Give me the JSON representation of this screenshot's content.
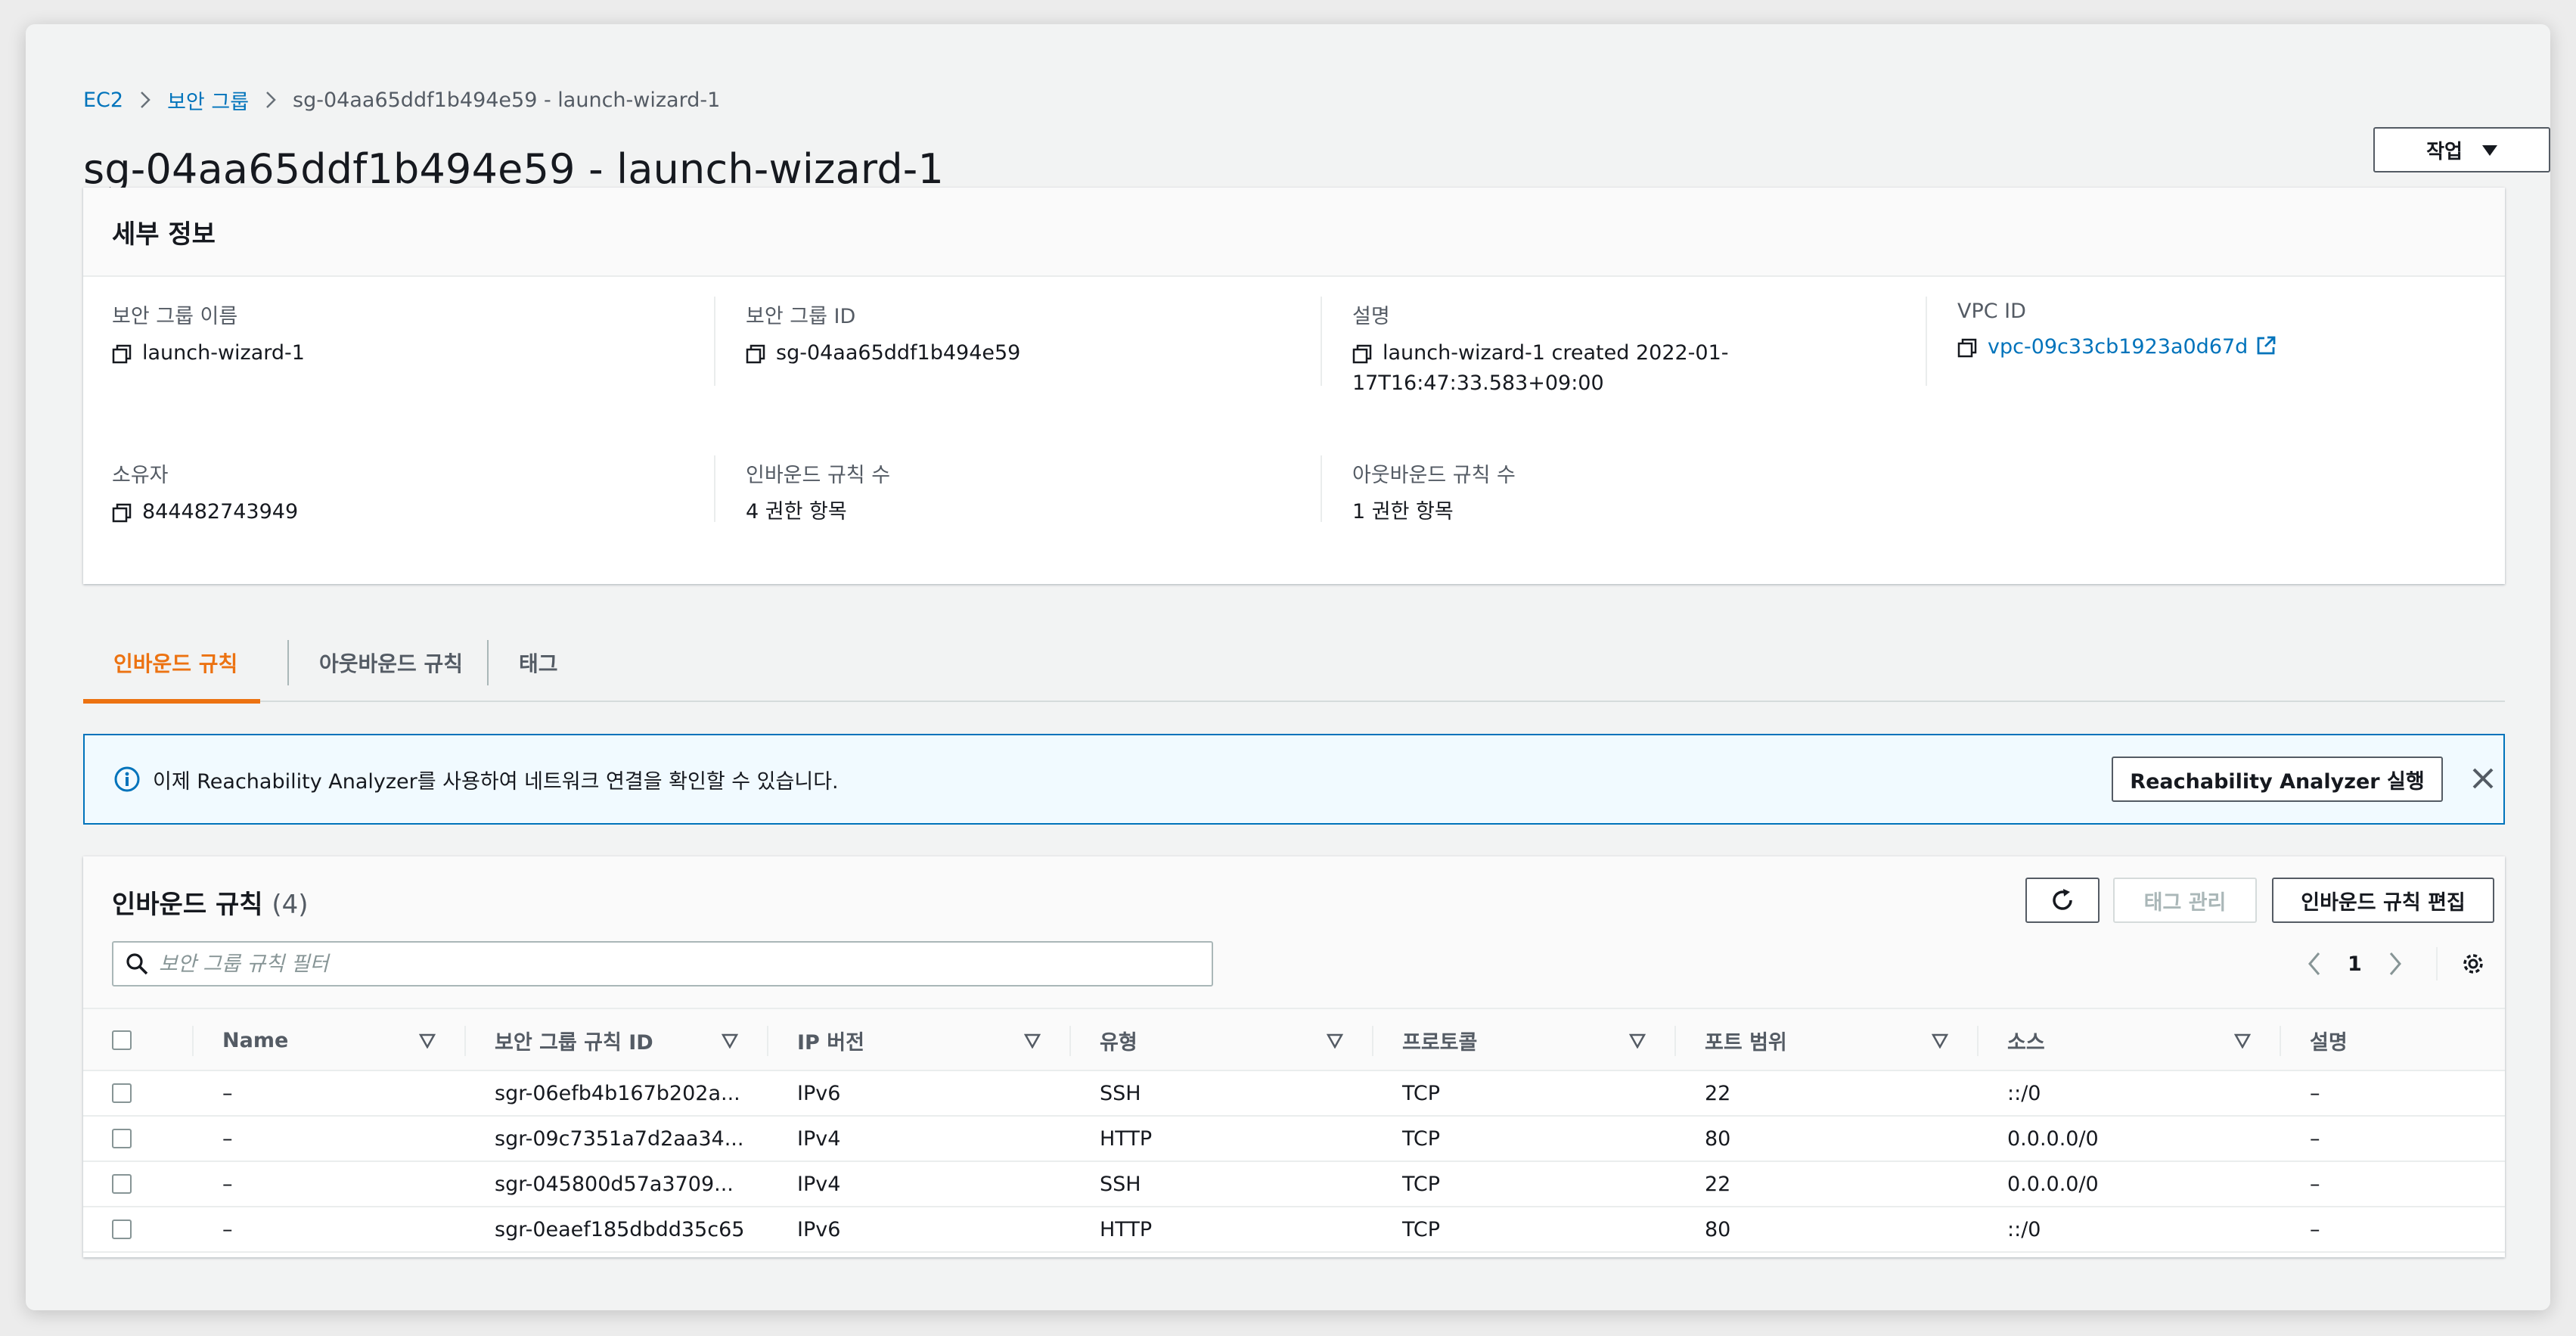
{
  "breadcrumb": {
    "items": [
      "EC2",
      "보안 그룹",
      "sg-04aa65ddf1b494e59 - launch-wizard-1"
    ]
  },
  "page_title": "sg-04aa65ddf1b494e59 - launch-wizard-1",
  "actions_label": "작업",
  "details": {
    "header": "세부 정보",
    "fields": {
      "sg_name": {
        "label": "보안 그룹 이름",
        "value": "launch-wizard-1"
      },
      "sg_id": {
        "label": "보안 그룹 ID",
        "value": "sg-04aa65ddf1b494e59"
      },
      "description": {
        "label": "설명",
        "value_line1": "launch-wizard-1 created 2022-01-",
        "value_line2": "17T16:47:33.583+09:00"
      },
      "vpc_id": {
        "label": "VPC ID",
        "value": "vpc-09c33cb1923a0d67d"
      },
      "owner": {
        "label": "소유자",
        "value": "844482743949"
      },
      "inbound_count": {
        "label": "인바운드 규칙 수",
        "value": "4 권한 항목"
      },
      "outbound_count": {
        "label": "아웃바운드 규칙 수",
        "value": "1 권한 항목"
      }
    }
  },
  "tabs": [
    "인바운드 규칙",
    "아웃바운드 규칙",
    "태그"
  ],
  "alert": {
    "text": "이제 Reachability Analyzer를 사용하여 네트워크 연결을 확인할 수 있습니다.",
    "button": "Reachability Analyzer 실행"
  },
  "rules": {
    "title": "인바운드 규칙",
    "count": "(4)",
    "manage_tags": "태그 관리",
    "edit_rules": "인바운드 규칙 편집",
    "search_placeholder": "보안 그룹 규칙 필터",
    "page": "1",
    "columns": [
      "Name",
      "보안 그룹 규칙 ID",
      "IP 버전",
      "유형",
      "프로토콜",
      "포트 범위",
      "소스",
      "설명"
    ],
    "rows": [
      [
        "–",
        "sgr-06efb4b167b202a...",
        "IPv6",
        "SSH",
        "TCP",
        "22",
        "::/0",
        "–"
      ],
      [
        "–",
        "sgr-09c7351a7d2aa34...",
        "IPv4",
        "HTTP",
        "TCP",
        "80",
        "0.0.0.0/0",
        "–"
      ],
      [
        "–",
        "sgr-045800d57a3709...",
        "IPv4",
        "SSH",
        "TCP",
        "22",
        "0.0.0.0/0",
        "–"
      ],
      [
        "–",
        "sgr-0eaef185dbdd35c65",
        "IPv6",
        "HTTP",
        "TCP",
        "80",
        "::/0",
        "–"
      ]
    ]
  },
  "colors": {
    "accent_orange": "#ec7211",
    "link_blue": "#0073bb",
    "alert_bg": "#f1faff"
  }
}
